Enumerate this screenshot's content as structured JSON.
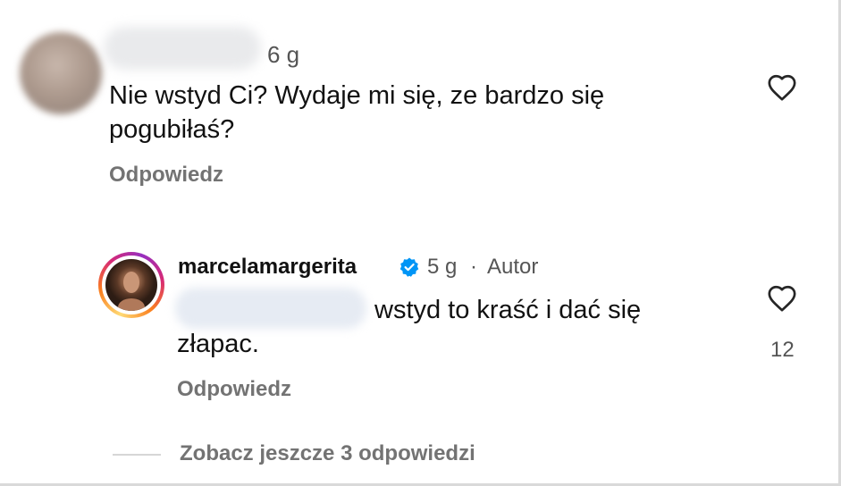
{
  "comments": [
    {
      "username_blurred": true,
      "time": "6 g",
      "text": "Nie wstyd Ci? Wydaje mi się, ze bardzo się pogubiłaś?",
      "reply_label": "Odpowiedz",
      "like_icon": "heart-outline-icon"
    },
    {
      "username": "marcelamargerita",
      "verified": true,
      "time": "5 g",
      "separator": "·",
      "author_badge": "Autor",
      "mention_blurred": true,
      "text_line1": "wstyd to kraść i dać się",
      "text_line2": "złapac.",
      "likes": "12",
      "reply_label": "Odpowiedz",
      "like_icon": "heart-outline-icon"
    }
  ],
  "view_more_replies": "Zobacz jeszcze 3 odpowiedzi",
  "colors": {
    "text_primary": "#111111",
    "text_secondary": "#737373",
    "verified_blue": "#0095f6"
  }
}
